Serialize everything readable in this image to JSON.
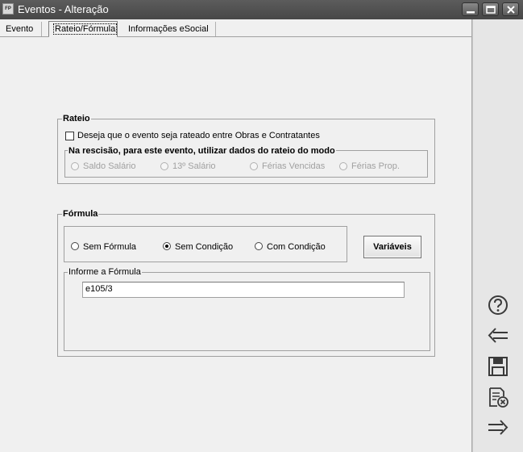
{
  "window": {
    "title": "Eventos - Alteração",
    "app_icon_text": "FP"
  },
  "tabs": [
    {
      "label": "Evento",
      "active": false
    },
    {
      "label": "Rateio/Fórmula",
      "active": true
    },
    {
      "label": "Informações eSocial",
      "active": false
    }
  ],
  "rateio": {
    "legend": "Rateio",
    "checkbox_label": "Deseja que o evento seja rateado entre Obras e Contratantes",
    "checkbox_checked": false,
    "rescisao_legend": "Na rescisão, para este evento, utilizar dados do rateio do modo",
    "options": [
      {
        "label": "Saldo Salário",
        "enabled": false
      },
      {
        "label": "13º Salário",
        "enabled": false
      },
      {
        "label": "Férias Vencidas",
        "enabled": false
      },
      {
        "label": "Férias Prop.",
        "enabled": false
      }
    ]
  },
  "formula": {
    "legend": "Fórmula",
    "options": [
      {
        "label": "Sem Fórmula",
        "checked": false
      },
      {
        "label": "Sem Condição",
        "checked": true
      },
      {
        "label": "Com Condição",
        "checked": false
      }
    ],
    "variaveis_label": "Variáveis",
    "informe_legend": "Informe a Fórmula",
    "value": "e105/3"
  },
  "sidebar": {
    "icons": [
      "help-icon",
      "back-arrow-icon",
      "save-icon",
      "cancel-document-icon",
      "forward-arrow-icon"
    ]
  },
  "colors": {
    "titlebar": "#4f4f4f",
    "background": "#f0f0f0",
    "sidebar": "#e6e6e6"
  }
}
